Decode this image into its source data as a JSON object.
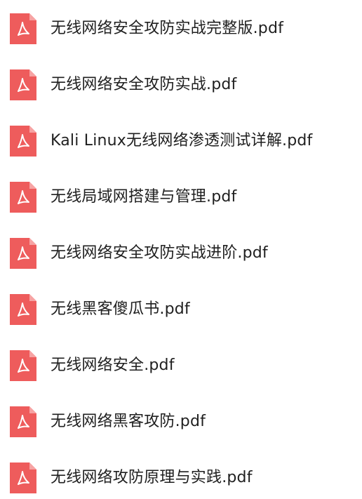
{
  "files": [
    {
      "name": "无线网络安全攻防实战完整版.pdf",
      "icon": "pdf-file-icon"
    },
    {
      "name": "无线网络安全攻防实战.pdf",
      "icon": "pdf-file-icon"
    },
    {
      "name": "Kali Linux无线网络渗透测试详解.pdf",
      "icon": "pdf-file-icon"
    },
    {
      "name": "无线局域网搭建与管理.pdf",
      "icon": "pdf-file-icon"
    },
    {
      "name": "无线网络安全攻防实战进阶.pdf",
      "icon": "pdf-file-icon"
    },
    {
      "name": "无线黑客傻瓜书.pdf",
      "icon": "pdf-file-icon"
    },
    {
      "name": "无线网络安全.pdf",
      "icon": "pdf-file-icon"
    },
    {
      "name": "无线网络黑客攻防.pdf",
      "icon": "pdf-file-icon"
    },
    {
      "name": "无线网络攻防原理与实践.pdf",
      "icon": "pdf-file-icon"
    }
  ],
  "colors": {
    "icon_red": "#ee5c5c",
    "icon_fold": "#f7a3a3",
    "text": "#1f1f1f"
  }
}
